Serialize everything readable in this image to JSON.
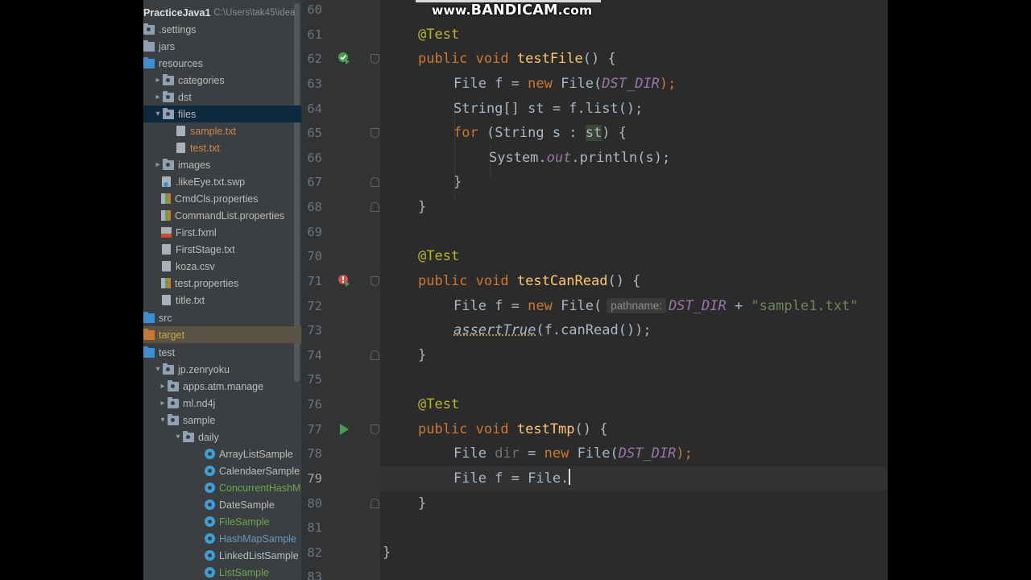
{
  "project": {
    "root_name": "PracticeJava1",
    "root_path": "C:\\Users\\tak45\\idea",
    "items": [
      {
        "label": ".settings",
        "indent": 0
      },
      {
        "label": "jars",
        "indent": 0
      },
      {
        "label": "resources",
        "indent": 0
      },
      {
        "label": "categories",
        "indent": 1
      },
      {
        "label": "dst",
        "indent": 1
      },
      {
        "label": "files",
        "indent": 1
      },
      {
        "label": "sample.txt",
        "indent": 2
      },
      {
        "label": "test.txt",
        "indent": 2
      },
      {
        "label": "images",
        "indent": 1
      },
      {
        "label": ".likeEye.txt.swp",
        "indent": 1
      },
      {
        "label": "CmdCls.properties",
        "indent": 1
      },
      {
        "label": "CommandList.properties",
        "indent": 1
      },
      {
        "label": "First.fxml",
        "indent": 1
      },
      {
        "label": "FirstStage.txt",
        "indent": 1
      },
      {
        "label": "koza.csv",
        "indent": 1
      },
      {
        "label": "test.properties",
        "indent": 1
      },
      {
        "label": "title.txt",
        "indent": 1
      },
      {
        "label": "src",
        "indent": 0
      },
      {
        "label": "target",
        "indent": 0
      },
      {
        "label": "test",
        "indent": 0
      },
      {
        "label": "jp.zenryoku",
        "indent": 1
      },
      {
        "label": "apps.atm.manage",
        "indent": 2
      },
      {
        "label": "ml.nd4j",
        "indent": 2
      },
      {
        "label": "sample",
        "indent": 2
      },
      {
        "label": "daily",
        "indent": 3
      },
      {
        "label": "ArrayListSample",
        "indent": 4
      },
      {
        "label": "CalendaerSample",
        "indent": 4
      },
      {
        "label": "ConcurrentHashMap",
        "indent": 4
      },
      {
        "label": "DateSample",
        "indent": 4
      },
      {
        "label": "FileSample",
        "indent": 4
      },
      {
        "label": "HashMapSample",
        "indent": 4
      },
      {
        "label": "LinkedListSample",
        "indent": 4
      },
      {
        "label": "ListSample",
        "indent": 4
      }
    ]
  },
  "editor": {
    "line_numbers": [
      "60",
      "61",
      "62",
      "63",
      "64",
      "65",
      "66",
      "67",
      "68",
      "69",
      "70",
      "71",
      "72",
      "73",
      "74",
      "75",
      "76",
      "77",
      "78",
      "79",
      "80",
      "81",
      "82",
      "83"
    ],
    "current_line": "79",
    "code": {
      "l61_ann": "@Test",
      "l62_kw1": "public",
      "l62_kw2": "void",
      "l62_fn": "testFile",
      "l62_rest": "() {",
      "l63_a": "File f = ",
      "l63_kw": "new",
      "l63_b": " File(",
      "l63_const": "DST_DIR",
      "l63_c": ");",
      "l64_a": "String[] st = f.list();",
      "l65_kw": "for",
      "l65_a": " (String s : ",
      "l65_hl": "st",
      "l65_b": ") {",
      "l66_a": "System.",
      "l66_fld": "out",
      "l66_b": ".println(s);",
      "l67": "}",
      "l68": "}",
      "l70_ann": "@Test",
      "l71_kw1": "public",
      "l71_kw2": "void",
      "l71_fn": "testCanRead",
      "l71_rest": "() {",
      "l72_a": "File f = ",
      "l72_kw": "new",
      "l72_b": " File(",
      "l72_hint": "pathname:",
      "l72_const": "DST_DIR",
      "l72_plus": " + ",
      "l72_str": "\"sample1.txt\"",
      "l73_fn": "assertTrue",
      "l73_a": "(f.canRead());",
      "l74": "}",
      "l76_ann": "@Test",
      "l77_kw1": "public",
      "l77_kw2": "void",
      "l77_fn": "testTmp",
      "l77_rest": "() {",
      "l78_a": "File ",
      "l78_unused": "dir",
      "l78_b": " = ",
      "l78_kw": "new",
      "l78_c": " File(",
      "l78_const": "DST_DIR",
      "l78_d": ");",
      "l79_a": "File f = File.",
      "l80": "}",
      "l82": "}"
    }
  },
  "watermark": {
    "prefix": "www.",
    "brand": "BANDICAM",
    "suffix": ".com"
  },
  "colors": {
    "editor_bg": "#2b2b2b",
    "tree_bg": "#3c3f41",
    "keyword": "#cc7832",
    "annotation": "#bbb529",
    "method": "#ffc66d",
    "constant": "#9876aa",
    "string": "#6a8759"
  }
}
